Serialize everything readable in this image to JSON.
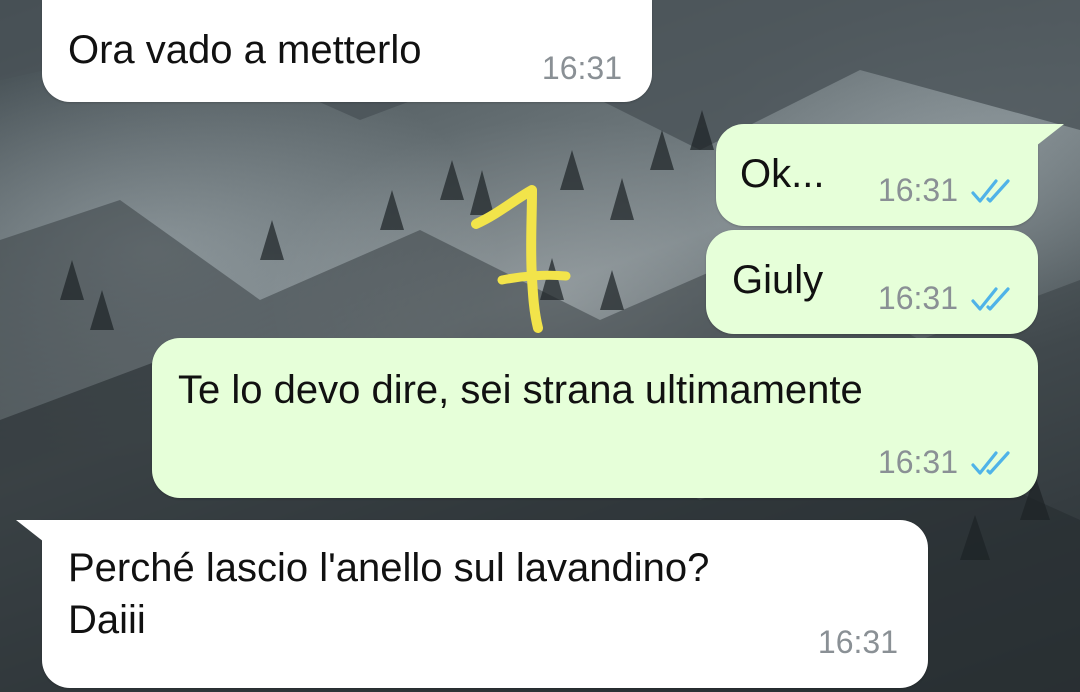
{
  "colors": {
    "incoming_bubble": "#ffffff",
    "outgoing_bubble": "#e6ffd9",
    "timestamp": "#8a9095",
    "read_ticks": "#4fb3e8",
    "annotation_stroke": "#f2e44a"
  },
  "background": {
    "description_icon": "snowy-mountain-wallpaper"
  },
  "messages": [
    {
      "direction": "incoming",
      "text": "Ora vado a metterlo",
      "time": "16:31"
    },
    {
      "direction": "outgoing",
      "text": "Ok...",
      "time": "16:31",
      "status": "read"
    },
    {
      "direction": "outgoing",
      "text": "Giuly",
      "time": "16:31",
      "status": "read"
    },
    {
      "direction": "outgoing",
      "text": "Te lo devo dire, sei strana ultimamente",
      "time": "16:31",
      "status": "read"
    },
    {
      "direction": "incoming",
      "text": "Perché lascio l'anello sul lavandino?\nDaiii",
      "time": "16:31"
    }
  ],
  "annotation": {
    "icon": "handwritten-number-1-annotation"
  }
}
